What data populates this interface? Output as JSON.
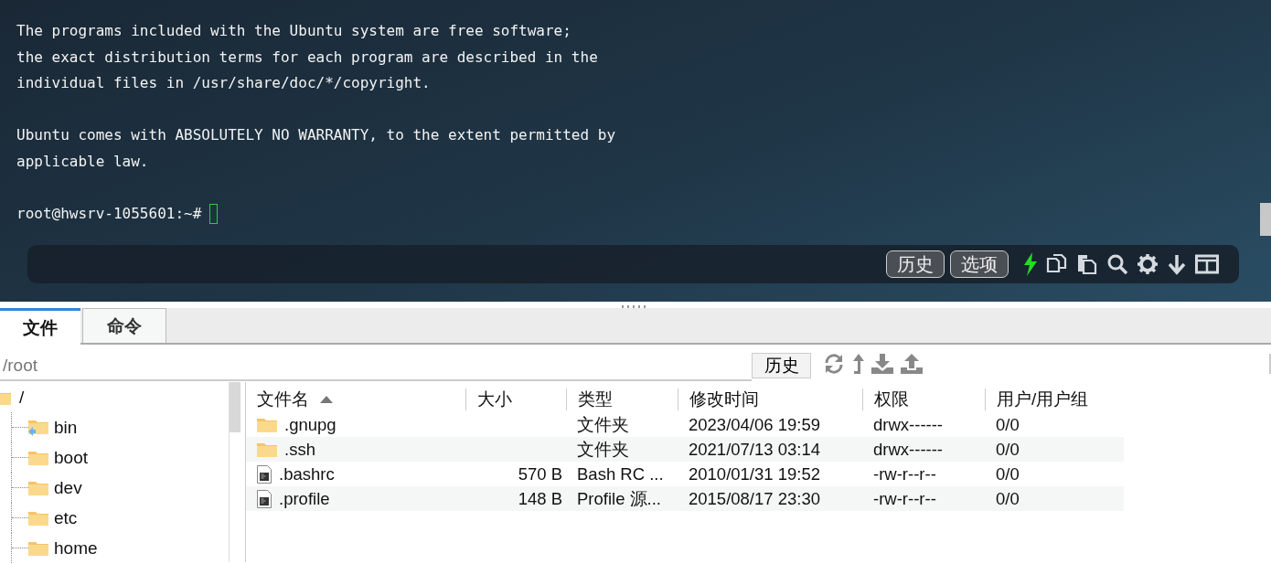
{
  "terminal": {
    "blocks": [
      [
        "The programs included with the Ubuntu system are free software;",
        "the exact distribution terms for each program are described in the",
        "individual files in /usr/share/doc/*/copyright."
      ],
      [
        "Ubuntu comes with ABSOLUTELY NO WARRANTY, to the extent permitted by",
        "applicable law."
      ]
    ],
    "prompt": "root@hwsrv-1055601:~#",
    "toolbar_buttons": [
      "历史",
      "选项"
    ]
  },
  "file_panel": {
    "tabs": [
      {
        "label": "文件",
        "selected": true
      },
      {
        "label": "命令",
        "selected": false
      }
    ],
    "path": {
      "value": "/root"
    },
    "history_button": "历史",
    "tree": {
      "label": "/",
      "children": [
        {
          "label": "bin",
          "symlink": true
        },
        {
          "label": "boot",
          "symlink": false
        },
        {
          "label": "dev",
          "symlink": false
        },
        {
          "label": "etc",
          "symlink": false
        },
        {
          "label": "home",
          "symlink": false
        }
      ]
    },
    "table": {
      "columns": [
        {
          "label": "文件名",
          "sorted": true
        },
        {
          "label": "大小",
          "sorted": false
        },
        {
          "label": "类型",
          "sorted": false
        },
        {
          "label": "修改时间",
          "sorted": false
        },
        {
          "label": "权限",
          "sorted": false
        },
        {
          "label": "用户/用户组",
          "sorted": false
        }
      ],
      "rows": [
        {
          "kind": "folder",
          "name": ".gnupg",
          "type": "文件夹",
          "modified": "2023/04/06 19:59",
          "permissions": "drwx------",
          "owner": "0/0"
        },
        {
          "kind": "folder",
          "name": ".ssh",
          "type": "文件夹",
          "modified": "2021/07/13 03:14",
          "permissions": "drwx------",
          "owner": "0/0"
        },
        {
          "kind": "file",
          "name": ".bashrc",
          "size": "570 B",
          "type": "Bash RC ...",
          "modified": "2010/01/31 19:52",
          "permissions": "-rw-r--r--",
          "owner": "0/0"
        },
        {
          "kind": "file",
          "name": ".profile",
          "size": "148 B",
          "type": "Profile 源...",
          "modified": "2015/08/17 23:30",
          "permissions": "-rw-r--r--",
          "owner": "0/0"
        }
      ]
    }
  }
}
